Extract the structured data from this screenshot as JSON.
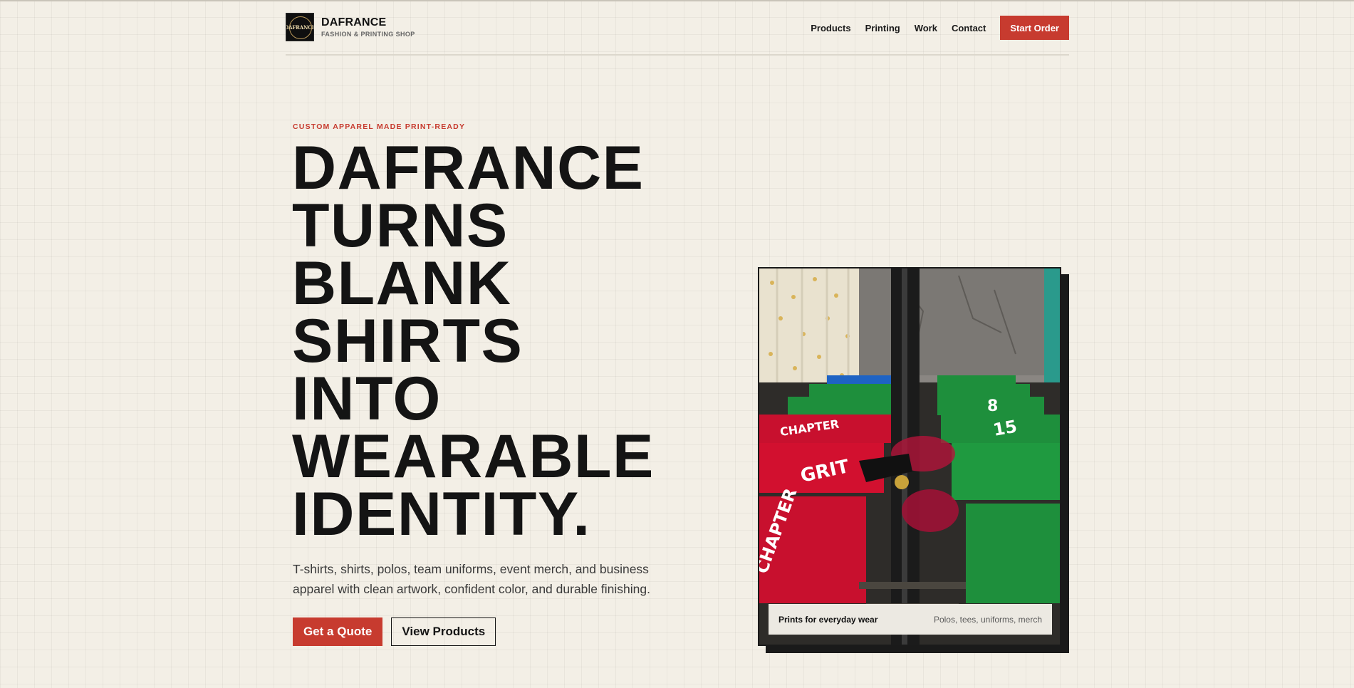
{
  "brand": {
    "logo_text": "DAFRANCE",
    "name": "DAFRANCE",
    "tagline": "FASHION & PRINTING SHOP"
  },
  "nav": {
    "links": [
      "Products",
      "Printing",
      "Work",
      "Contact"
    ],
    "cta_label": "Start Order"
  },
  "hero": {
    "eyebrow": "CUSTOM APPAREL MADE PRINT-READY",
    "headline_lines": [
      "DAFRANCE",
      "TURNS",
      "BLANK",
      "SHIRTS",
      "INTO",
      "WEARABLE",
      "IDENTITY."
    ],
    "description": "T-shirts, shirts, polos, team uniforms, event merch, and business apparel with clean artwork, confident color, and durable finishing.",
    "primary_cta": "Get a Quote",
    "secondary_cta": "View Products"
  },
  "photo": {
    "shirt_prints": [
      "CHAPTER",
      "GRIT",
      "CHAPTER",
      "8",
      "15"
    ],
    "caption_title": "Prints for everyday wear",
    "caption_sub": "Polos, tees, uniforms, merch"
  },
  "colors": {
    "accent": "#c73b2f",
    "background": "#f3efe6",
    "ink": "#141414",
    "shirt_red": "#c8102e",
    "shirt_green": "#1e8f3c"
  }
}
